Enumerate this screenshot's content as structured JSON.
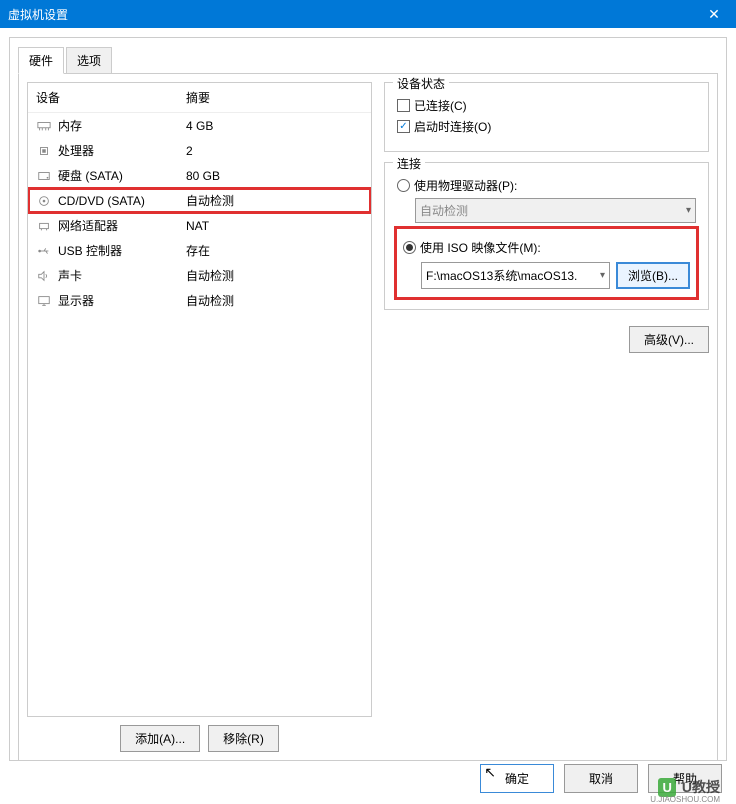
{
  "window": {
    "title": "虚拟机设置",
    "close": "✕"
  },
  "tabs": {
    "hardware": "硬件",
    "options": "选项"
  },
  "headers": {
    "device": "设备",
    "summary": "摘要"
  },
  "devices": [
    {
      "icon": "memory-icon",
      "name": "内存",
      "summary": "4 GB"
    },
    {
      "icon": "cpu-icon",
      "name": "处理器",
      "summary": "2"
    },
    {
      "icon": "hdd-icon",
      "name": "硬盘 (SATA)",
      "summary": "80 GB"
    },
    {
      "icon": "disc-icon",
      "name": "CD/DVD (SATA)",
      "summary": "自动检测",
      "selected": true
    },
    {
      "icon": "network-icon",
      "name": "网络适配器",
      "summary": "NAT"
    },
    {
      "icon": "usb-icon",
      "name": "USB 控制器",
      "summary": "存在"
    },
    {
      "icon": "sound-icon",
      "name": "声卡",
      "summary": "自动检测"
    },
    {
      "icon": "display-icon",
      "name": "显示器",
      "summary": "自动检测"
    }
  ],
  "buttons": {
    "add": "添加(A)...",
    "remove": "移除(R)",
    "advanced": "高级(V)...",
    "browse": "浏览(B)...",
    "ok": "确定",
    "cancel": "取消",
    "help": "帮助"
  },
  "status_group": {
    "title": "设备状态",
    "connected": "已连接(C)",
    "connect_on_power": "启动时连接(O)"
  },
  "connection_group": {
    "title": "连接",
    "physical": "使用物理驱动器(P):",
    "auto_detect": "自动检测",
    "use_iso": "使用 ISO 映像文件(M):",
    "iso_path": "F:\\macOS13系统\\macOS13."
  },
  "watermark": {
    "badge": "U",
    "text": "U教授",
    "sub": "U.JIAOSHOU.COM"
  }
}
